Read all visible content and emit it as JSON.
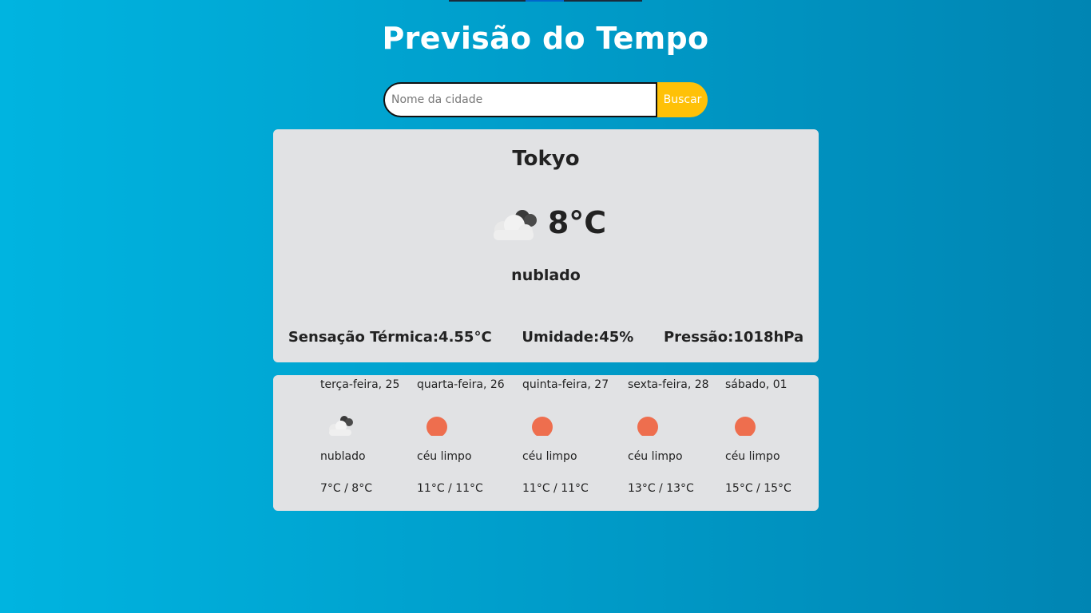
{
  "title": "Previsão do Tempo",
  "search": {
    "placeholder": "Nome da cidade",
    "value": "",
    "button_label": "Buscar"
  },
  "current": {
    "city": "Tokyo",
    "temperature": "8°C",
    "icon": "cloudy-icon",
    "description": "nublado",
    "feels_like_label": "Sensação Térmica:",
    "feels_like": "4.55°C",
    "humidity_label": "Umidade:",
    "humidity": "45%",
    "pressure_label": "Pressão:",
    "pressure": "1018hPa"
  },
  "forecast": [
    {
      "date": "terça-feira, 25",
      "icon": "cloudy-icon",
      "description": "nublado",
      "range": "7°C / 8°C"
    },
    {
      "date": "quarta-feira, 26",
      "icon": "sun-icon",
      "description": "céu limpo",
      "range": "11°C / 11°C"
    },
    {
      "date": "quinta-feira, 27",
      "icon": "sun-icon",
      "description": "céu limpo",
      "range": "11°C / 11°C"
    },
    {
      "date": "sexta-feira, 28",
      "icon": "sun-icon",
      "description": "céu limpo",
      "range": "13°C / 13°C"
    },
    {
      "date": "sábado, 01",
      "icon": "sun-icon",
      "description": "céu limpo",
      "range": "15°C / 15°C"
    }
  ],
  "colors": {
    "background_start": "#00b4e0",
    "background_end": "#0085b3",
    "button": "#ffc107",
    "card": "#e1e2e4",
    "sun": "#ee6e4e"
  }
}
